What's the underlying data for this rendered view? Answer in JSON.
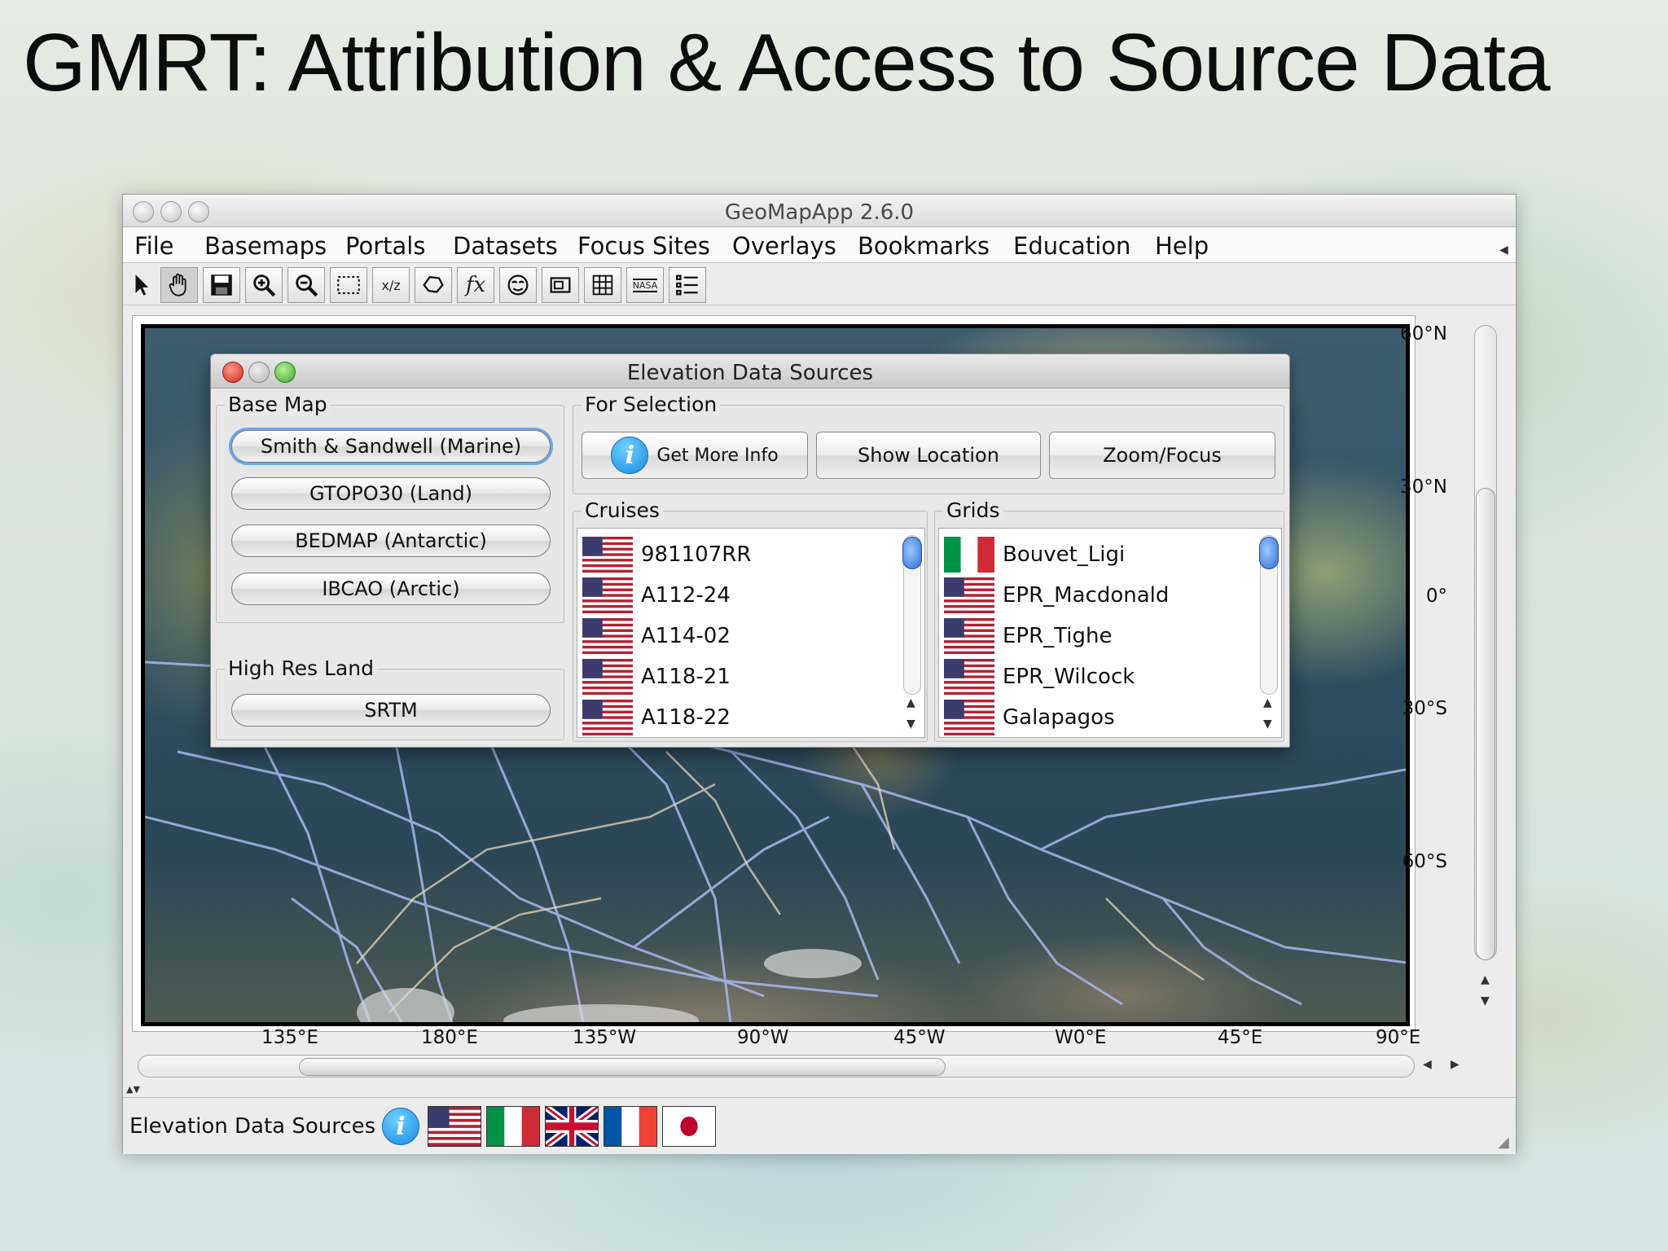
{
  "slide": {
    "title": "GMRT: Attribution & Access to Source Data"
  },
  "window": {
    "title": "GeoMapApp 2.6.0"
  },
  "menu": [
    "File",
    "Basemaps",
    "Portals",
    "Datasets",
    "Focus Sites",
    "Overlays",
    "Bookmarks",
    "Education",
    "Help"
  ],
  "toolbar": {
    "tools": [
      "select-icon",
      "pan-hand-icon",
      "save-icon",
      "zoom-in-icon",
      "zoom-out-icon",
      "rectangle-select-icon",
      "xyz-profile-icon",
      "lasso-icon",
      "function-fx-icon",
      "mask-icon",
      "frame-icon",
      "grid-icon",
      "nasa-grid-icon",
      "list-icon"
    ],
    "fx_label": "fx",
    "nasa_label": "NASA",
    "xyz_label": "x/z"
  },
  "map": {
    "lat_labels": [
      "60°N",
      "30°N",
      "0°",
      "30°S",
      "60°S"
    ],
    "lon_labels": [
      "135°E",
      "180°E",
      "135°W",
      "90°W",
      "45°W",
      "W0°E",
      "45°E",
      "90°E"
    ]
  },
  "dialog": {
    "title": "Elevation Data Sources",
    "base_map": {
      "label": "Base Map",
      "buttons": [
        "Smith & Sandwell (Marine)",
        "GTOPO30 (Land)",
        "BEDMAP (Antarctic)",
        "IBCAO (Arctic)"
      ]
    },
    "high_res_land": {
      "label": "High Res Land",
      "button": "SRTM"
    },
    "for_selection": {
      "label": "For Selection",
      "info_button": "Get More Info",
      "show_location": "Show Location",
      "zoom_focus": "Zoom/Focus",
      "info_glyph": "i"
    },
    "cruises": {
      "label": "Cruises",
      "items": [
        {
          "name": "981107RR",
          "flag": "us"
        },
        {
          "name": "A112-24",
          "flag": "us"
        },
        {
          "name": "A114-02",
          "flag": "us"
        },
        {
          "name": "A118-21",
          "flag": "us"
        },
        {
          "name": "A118-22",
          "flag": "us"
        }
      ]
    },
    "grids": {
      "label": "Grids",
      "items": [
        {
          "name": "Bouvet_Ligi",
          "flag": "it"
        },
        {
          "name": "EPR_Macdonald",
          "flag": "us"
        },
        {
          "name": "EPR_Tighe",
          "flag": "us"
        },
        {
          "name": "EPR_Wilcock",
          "flag": "us"
        },
        {
          "name": "Galapagos",
          "flag": "us"
        }
      ]
    }
  },
  "status": {
    "label": "Elevation Data Sources",
    "info_glyph": "i",
    "flags": [
      "us",
      "it",
      "uk",
      "fr",
      "jp"
    ]
  }
}
